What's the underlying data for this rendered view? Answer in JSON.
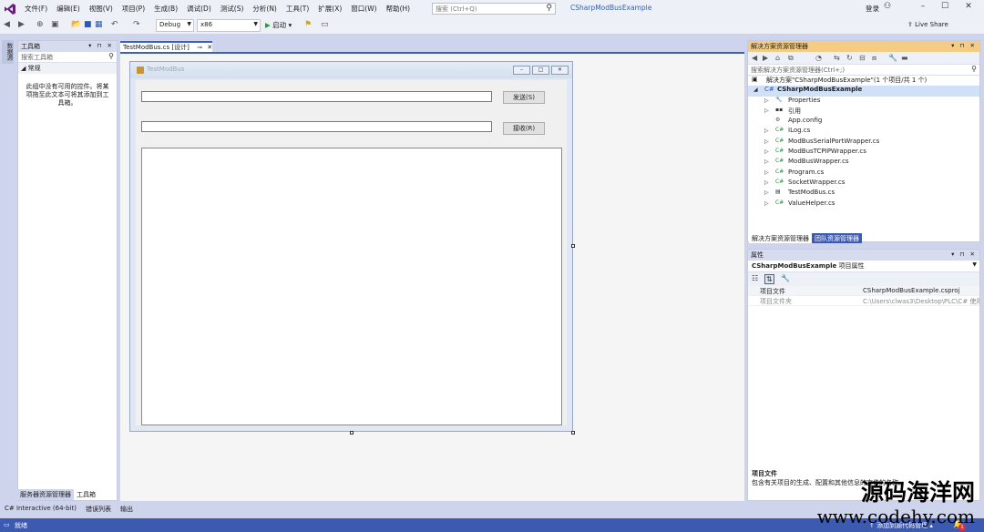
{
  "menu": [
    "文件(F)",
    "编辑(E)",
    "视图(V)",
    "项目(P)",
    "生成(B)",
    "调试(D)",
    "测试(S)",
    "分析(N)",
    "工具(T)",
    "扩展(X)",
    "窗口(W)",
    "帮助(H)"
  ],
  "search": {
    "placeholder": "搜索 (Ctrl+Q)"
  },
  "solution_title": "CSharpModBusExample",
  "login": "登录",
  "live_share": "Live Share",
  "toolbar": {
    "config": "Debug",
    "platform": "x86",
    "start": "启动"
  },
  "left_vertical_tab": "数据源",
  "toolbox": {
    "title": "工具箱",
    "search_placeholder": "搜索工具箱",
    "group": "常规",
    "empty_msg": "此组中没有可用的控件。将某项拖至此文本可将其添加到工具箱。"
  },
  "left_bottom_tabs": [
    "服务器资源管理器",
    "工具箱"
  ],
  "doc_tab": "TestModBus.cs [设计]",
  "form": {
    "title": "TestModBus",
    "send_label": "发送(S)",
    "receive_label": "接收(R)"
  },
  "solution_explorer": {
    "title": "解决方案资源管理器",
    "search_placeholder": "搜索解决方案资源管理器(Ctrl+;)",
    "solution_label": "解决方案\"CSharpModBusExample\"(1 个项目/共 1 个)",
    "project": "CSharpModBusExample",
    "items": [
      {
        "label": "Properties",
        "icon": "wrench-icon",
        "expandable": true
      },
      {
        "label": "引用",
        "icon": "references-icon",
        "expandable": true
      },
      {
        "label": "App.config",
        "icon": "config-file-icon",
        "expandable": false
      },
      {
        "label": "ILog.cs",
        "icon": "csharp-file-icon",
        "expandable": true
      },
      {
        "label": "ModBusSerialPortWrapper.cs",
        "icon": "csharp-file-icon",
        "expandable": true
      },
      {
        "label": "ModBusTCPIPWrapper.cs",
        "icon": "csharp-file-icon",
        "expandable": true
      },
      {
        "label": "ModBusWrapper.cs",
        "icon": "csharp-file-icon",
        "expandable": true
      },
      {
        "label": "Program.cs",
        "icon": "csharp-file-icon",
        "expandable": true
      },
      {
        "label": "SocketWrapper.cs",
        "icon": "csharp-file-icon",
        "expandable": true
      },
      {
        "label": "TestModBus.cs",
        "icon": "form-file-icon",
        "expandable": true
      },
      {
        "label": "ValueHelper.cs",
        "icon": "csharp-file-icon",
        "expandable": true
      }
    ]
  },
  "right_bottom_tabs": [
    "解决方案资源管理器",
    "团队资源管理器"
  ],
  "properties": {
    "title": "属性",
    "object_name": "CSharpModBusExample",
    "object_type": "项目属性",
    "rows": [
      {
        "key": "项目文件",
        "value": "CSharpModBusExample.csproj"
      },
      {
        "key": "项目文件夹",
        "value": "C:\\Users\\clwas3\\Desktop\\PLC\\C# 使用"
      }
    ],
    "desc_title": "项目文件",
    "desc_text": "包含有关项目的生成、配置和其他信息的文件的名称。"
  },
  "output_tabs": [
    "C# Interactive (64-bit)",
    "错误列表",
    "输出"
  ],
  "status": {
    "ready": "就绪",
    "add_source": "添加到源代码管理",
    "notifications": "1"
  },
  "watermark": {
    "line1": "源码海洋网",
    "line2": "www.codehy.com"
  }
}
